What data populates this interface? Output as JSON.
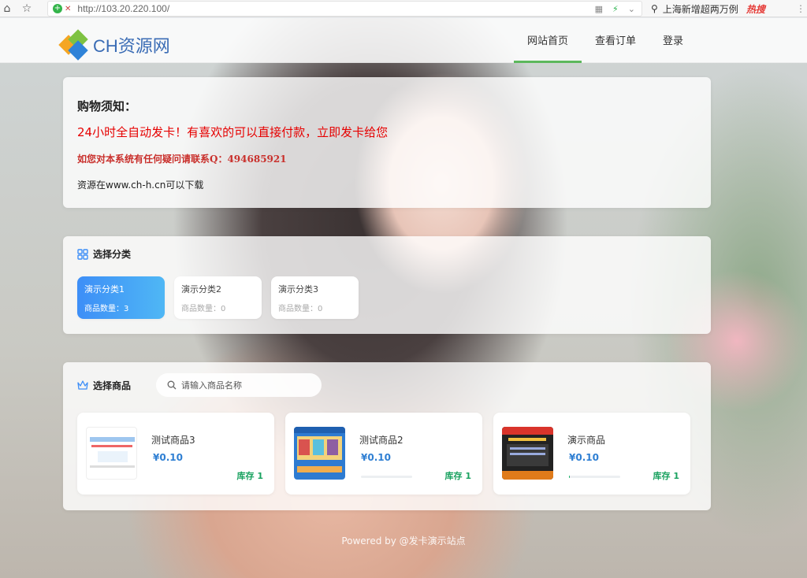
{
  "browser": {
    "url": "http://103.20.220.100/",
    "search_hint": "上海新增超两万例",
    "hot_label": "热搜"
  },
  "header": {
    "logo_text": "CH资源网",
    "nav": [
      "网站首页",
      "查看订单",
      "登录"
    ],
    "active_nav": 0
  },
  "notice": {
    "title": "购物须知：",
    "line1": "24小时全自动发卡！有喜欢的可以直接付款，立即发卡给您",
    "line2": "如您对本系统有任何疑问请联系Q：494685921",
    "line3": "资源在www.ch-h.cn可以下载"
  },
  "categories": {
    "title": "选择分类",
    "items": [
      {
        "name": "演示分类1",
        "count": "商品数量：3"
      },
      {
        "name": "演示分类2",
        "count": "商品数量：0"
      },
      {
        "name": "演示分类3",
        "count": "商品数量：0"
      }
    ]
  },
  "goods": {
    "title": "选择商品",
    "search_placeholder": "请输入商品名称",
    "items": [
      {
        "name": "测试商品3",
        "price": "¥0.10",
        "stock": "库存 1",
        "stock_level": 1.0
      },
      {
        "name": "测试商品2",
        "price": "¥0.10",
        "stock": "库存 1",
        "stock_level": 0.0
      },
      {
        "name": "演示商品",
        "price": "¥0.10",
        "stock": "库存 1",
        "stock_level": 0.02
      }
    ]
  },
  "footer": {
    "text": "Powered by @发卡演示站点"
  },
  "colors": {
    "accent": "#5cb85c",
    "category_active": "#3d8ef7",
    "price": "#2f7fd3",
    "stock": "#1aa260",
    "notice_red": "#e60000"
  }
}
